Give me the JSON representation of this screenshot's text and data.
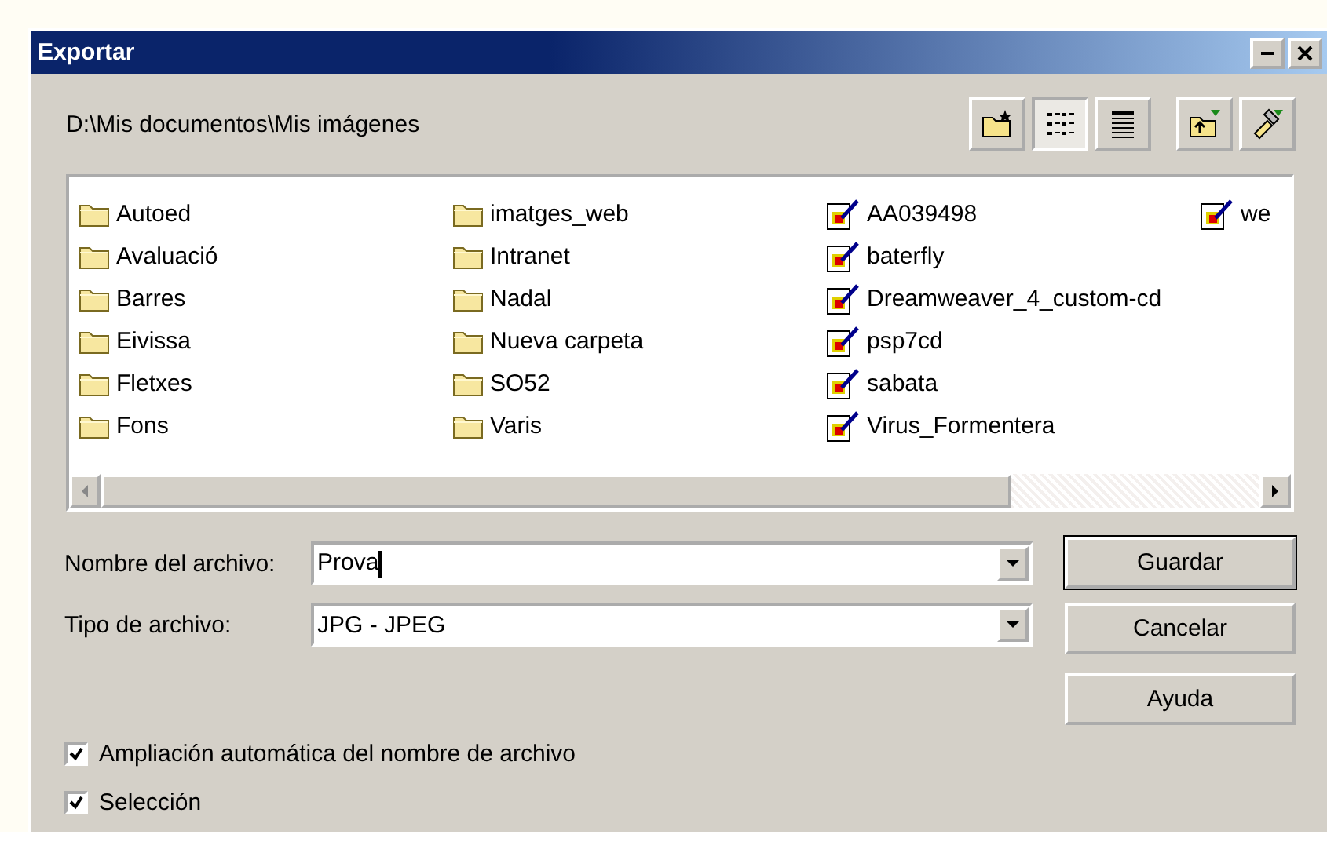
{
  "window": {
    "title": "Exportar"
  },
  "path": "D:\\Mis documentos\\Mis imágenes",
  "toolbar": [
    {
      "kind": "new-folder",
      "selected": false
    },
    {
      "kind": "list",
      "selected": true
    },
    {
      "kind": "details",
      "selected": false
    },
    {
      "kind": "up",
      "selected": false
    },
    {
      "kind": "tools",
      "selected": false
    }
  ],
  "files": [
    {
      "name": "Autoed",
      "kind": "folder"
    },
    {
      "name": "Avaluació",
      "kind": "folder"
    },
    {
      "name": "Barres",
      "kind": "folder"
    },
    {
      "name": "Eivissa",
      "kind": "folder"
    },
    {
      "name": "Fletxes",
      "kind": "folder"
    },
    {
      "name": "Fons",
      "kind": "folder"
    },
    {
      "name": "imatges_web",
      "kind": "folder"
    },
    {
      "name": "Intranet",
      "kind": "folder"
    },
    {
      "name": "Nadal",
      "kind": "folder"
    },
    {
      "name": "Nueva carpeta",
      "kind": "folder"
    },
    {
      "name": "SO52",
      "kind": "folder"
    },
    {
      "name": "Varis",
      "kind": "folder"
    },
    {
      "name": "AA039498",
      "kind": "image"
    },
    {
      "name": "baterfly",
      "kind": "image"
    },
    {
      "name": "Dreamweaver_4_custom-cd",
      "kind": "image"
    },
    {
      "name": "psp7cd",
      "kind": "image"
    },
    {
      "name": "sabata",
      "kind": "image"
    },
    {
      "name": "Virus_Formentera",
      "kind": "image"
    },
    {
      "name": "we",
      "kind": "image"
    }
  ],
  "fields": [
    {
      "label": "Nombre del archivo:",
      "value": "Prova"
    },
    {
      "label": "Tipo de archivo:",
      "value": "JPG - JPEG"
    }
  ],
  "buttons": [
    "Guardar",
    "Cancelar",
    "Ayuda"
  ],
  "options": [
    {
      "label": "Ampliación automática del nombre de archivo",
      "checked": true
    },
    {
      "label": "Selección",
      "checked": true
    }
  ]
}
